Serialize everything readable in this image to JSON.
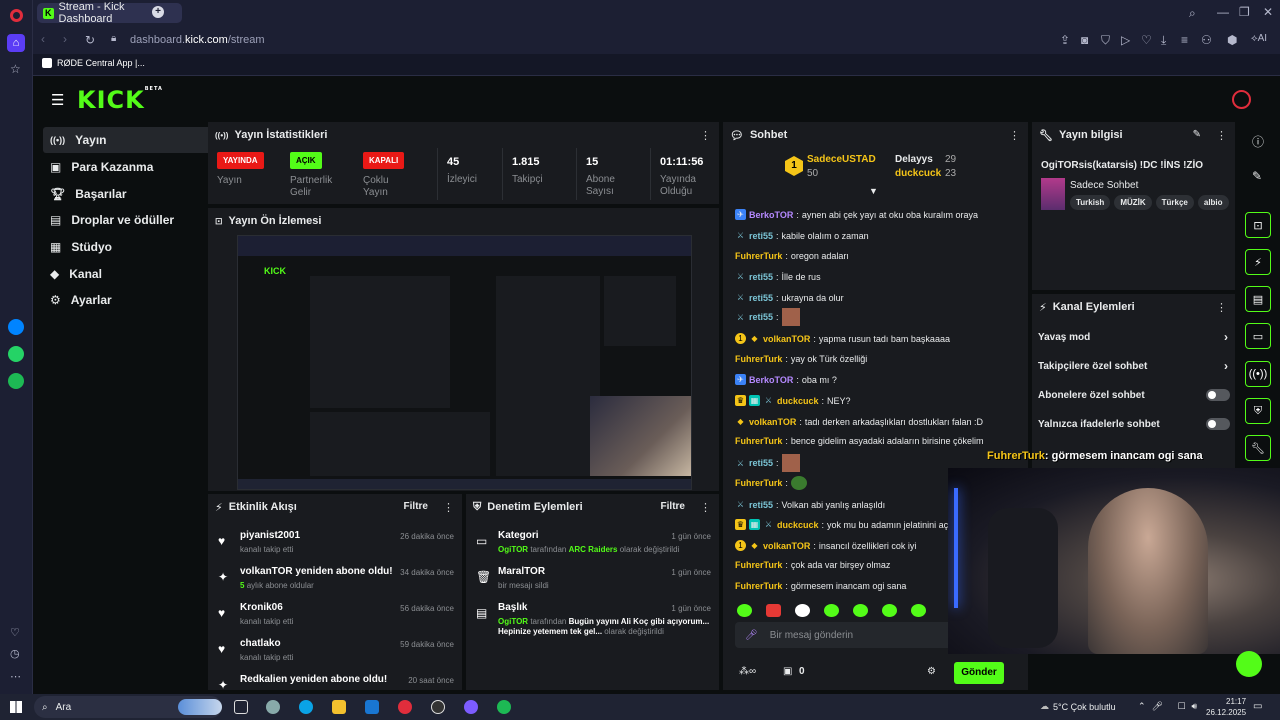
{
  "browser": {
    "tab_title": "Stream - Kick Dashboard",
    "url_prefix": "dashboard.",
    "url_domain": "kick.com",
    "url_path": "/stream",
    "bookmark": "RØDE Central App |...",
    "ai_label": "AI"
  },
  "app": {
    "logo": "KICK",
    "logo_beta": "BETA",
    "sidebar": [
      {
        "label": "Yayın",
        "chevron": false
      },
      {
        "label": "Para Kazanma",
        "chevron": true
      },
      {
        "label": "Başarılar",
        "chevron": false
      },
      {
        "label": "Droplar ve ödüller",
        "chevron": false
      },
      {
        "label": "Stüdyo",
        "chevron": true
      },
      {
        "label": "Kanal",
        "chevron": true
      },
      {
        "label": "Ayarlar",
        "chevron": true
      }
    ]
  },
  "stats": {
    "title": "Yayın İstatistikleri",
    "items": [
      {
        "value": "YAYINDA",
        "label": "Yayın",
        "badge": true,
        "color": "#e91916"
      },
      {
        "value": "AÇIK",
        "label": "Partnerlik Gelir",
        "badge": true,
        "color": "#53fc18"
      },
      {
        "value": "KAPALI",
        "label": "Çoklu Yayın",
        "badge": true,
        "color": "#e91916"
      },
      {
        "value": "45",
        "label": "İzleyici",
        "badge": false
      },
      {
        "value": "1.815",
        "label": "Takipçi",
        "badge": false
      },
      {
        "value": "15",
        "label": "Abone Sayısı",
        "badge": false
      },
      {
        "value": "01:11:56",
        "label": "Yayında Olduğu",
        "badge": false
      }
    ]
  },
  "preview": {
    "title": "Yayın Ön İzlemesi"
  },
  "activity": {
    "title": "Etkinlik Akışı",
    "filter": "Filtre",
    "items": [
      {
        "title": "piyanist2001",
        "sub": "kanalı takip etti",
        "time": "26 dakika önce"
      },
      {
        "title": "volkanTOR yeniden abone oldu!",
        "sub_num": "5",
        "sub": "aylık abone oldular",
        "time": "34 dakika önce"
      },
      {
        "title": "Kronik06",
        "sub": "kanalı takip etti",
        "time": "56 dakika önce"
      },
      {
        "title": "chatlako",
        "sub": "kanalı takip etti",
        "time": "59 dakika önce"
      },
      {
        "title": "Redkalien yeniden abone oldu!",
        "sub": "",
        "time": "20 saat önce"
      }
    ]
  },
  "moderation": {
    "title": "Denetim Eylemleri",
    "filter": "Filtre",
    "items": [
      {
        "title": "Kategori",
        "user": "OgiTOR",
        "mid": "tarafından",
        "target": "ARC Raiders",
        "rest": "olarak değiştirildi",
        "time": "1 gün önce"
      },
      {
        "title": "MaralTOR",
        "user": "",
        "mid": "",
        "target": "",
        "rest": "bir mesajı sildi",
        "time": "1 gün önce"
      },
      {
        "title": "Başlık",
        "user": "OgiTOR",
        "mid": "tarafından",
        "target": "Bugün yayını Ali Koç gibi açıyorum... Hepinize yetemem tek gel...",
        "rest": "olarak değiştirildi",
        "time": "1 gün önce"
      }
    ]
  },
  "chat": {
    "title": "Sohbet",
    "top": {
      "rank": "1",
      "name": "SadeceUSTAD",
      "score": "50",
      "p2": "Delayys",
      "p2_score": "29",
      "p3": "duckcuck",
      "p3_score": "23"
    },
    "messages": [
      {
        "user": "BerkoTOR",
        "color": "purple",
        "text": "aynen abi çek yayı at oku oba kuralım oraya"
      },
      {
        "user": "reti55",
        "color": "teal",
        "text": "kabile olalım o zaman"
      },
      {
        "user": "FuhrerTurk",
        "color": "yellow",
        "text": "oregon adaları"
      },
      {
        "user": "reti55",
        "color": "teal",
        "text": "İlle de rus"
      },
      {
        "user": "reti55",
        "color": "teal",
        "text": "ukrayna da olur"
      },
      {
        "user": "reti55",
        "color": "teal",
        "text": ""
      },
      {
        "user": "volkanTOR",
        "color": "yellow",
        "text": "yapma rusun tadı bam başkaaaa"
      },
      {
        "user": "FuhrerTurk",
        "color": "yellow",
        "text": "yay ok Türk özelliği"
      },
      {
        "user": "BerkoTOR",
        "color": "purple",
        "text": "oba mı ?"
      },
      {
        "user": "duckcuck",
        "color": "yellow",
        "text": "NEY?"
      },
      {
        "user": "volkanTOR",
        "color": "yellow",
        "text": "tadı derken arkadaşlıkları dostlukları falan :D"
      },
      {
        "user": "FuhrerTurk",
        "color": "yellow",
        "text": "bence gidelim asyadaki adaların birisine çökelim"
      },
      {
        "user": "reti55",
        "color": "teal",
        "text": ""
      },
      {
        "user": "FuhrerTurk",
        "color": "yellow",
        "text": ""
      },
      {
        "user": "reti55",
        "color": "teal",
        "text": "Volkan abi yanlış anlaşıldı"
      },
      {
        "user": "duckcuck",
        "color": "yellow",
        "text": "yok mu bu adamın jelatinini aç"
      },
      {
        "user": "volkanTOR",
        "color": "yellow",
        "text": "insancıl özellikleri cok iyi"
      },
      {
        "user": "FuhrerTurk",
        "color": "yellow",
        "text": "çok ada var birşey olmaz"
      },
      {
        "user": "FuhrerTurk",
        "color": "yellow",
        "text": "görmesem inancam ogi sana"
      }
    ],
    "input_placeholder": "Bir mesaj gönderin",
    "count": "0",
    "send": "Gönder"
  },
  "stream_info": {
    "title": "Yayın bilgisi",
    "stream_title": "OgiTORsis(katarsis) !DC !İNS !ZİO",
    "category": "Sadece Sohbet",
    "tags": [
      "Turkish",
      "MÜZİK",
      "Türkçe",
      "albio"
    ]
  },
  "channel_actions": {
    "title": "Kanal Eylemleri",
    "items": [
      {
        "label": "Yavaş mod",
        "type": "arrow"
      },
      {
        "label": "Takipçilere özel sohbet",
        "type": "arrow"
      },
      {
        "label": "Abonelere özel sohbet",
        "type": "toggle"
      },
      {
        "label": "Yalnızca ifadelerle sohbet",
        "type": "toggle"
      }
    ]
  },
  "overlay_chat": {
    "user": "FuhrerTurk",
    "text": "görmesem inancam ogi sana"
  },
  "taskbar": {
    "search": "Ara",
    "weather": "5°C  Çok bulutlu",
    "time": "21:17",
    "date": "26.12.2025"
  },
  "colors": {
    "kick_green": "#53fc18",
    "live_red": "#e91916"
  }
}
